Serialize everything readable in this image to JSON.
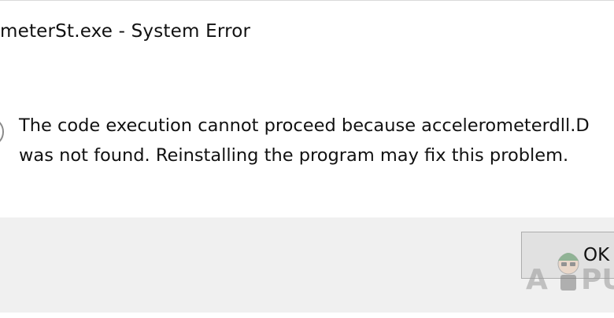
{
  "dialog": {
    "title": "meterSt.exe - System Error",
    "icon": "error-icon",
    "message_line1": "The code execution cannot proceed because accelerometerdll.D",
    "message_line2": "was not found. Reinstalling the program may fix this problem.",
    "ok_label": "OK"
  },
  "watermark": {
    "text_left": "A",
    "text_right": "PU"
  },
  "colors": {
    "footer_bg": "#f0f0f0",
    "button_bg": "#e1e1e1",
    "button_border": "#adadad",
    "text": "#111111"
  }
}
